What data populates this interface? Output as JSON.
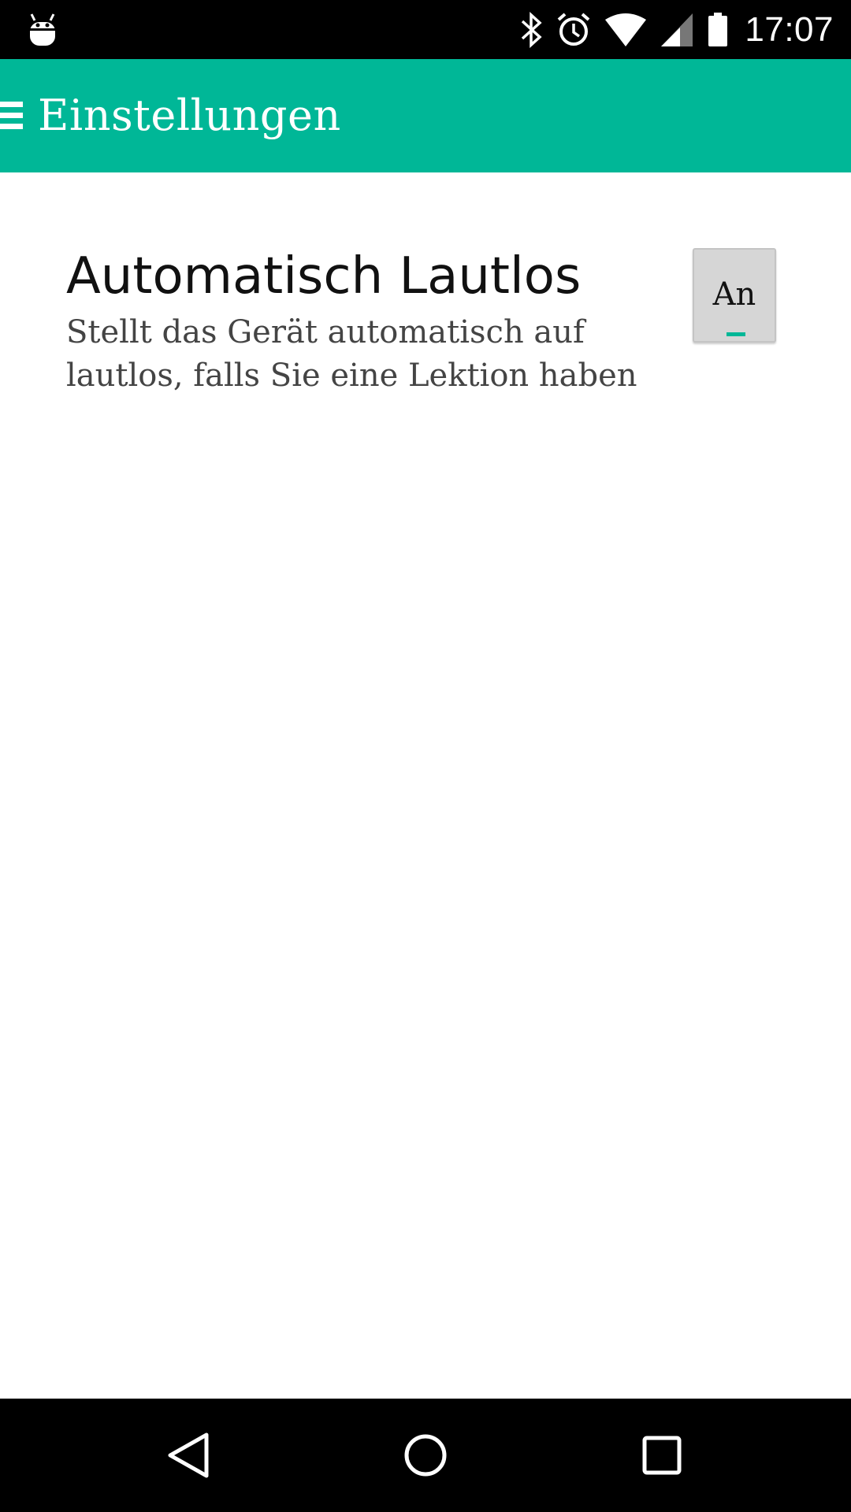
{
  "status_bar": {
    "time": "17:07",
    "icons": [
      "android-debug-icon",
      "bluetooth-icon",
      "alarm-icon",
      "wifi-icon",
      "cellular-signal-icon",
      "battery-icon"
    ]
  },
  "app_bar": {
    "title": "Einstellungen",
    "background_color": "#00B797",
    "menu_icon": "hamburger-menu-icon"
  },
  "settings": {
    "auto_silent": {
      "title": "Automatisch Lautlos",
      "summary": "Stellt das Gerät automatisch auf lautlos, falls Sie eine Lektion haben",
      "toggle_label": "An",
      "toggle_state": true
    }
  },
  "nav_bar": {
    "icons": [
      "back-icon",
      "home-icon",
      "recents-icon"
    ]
  }
}
